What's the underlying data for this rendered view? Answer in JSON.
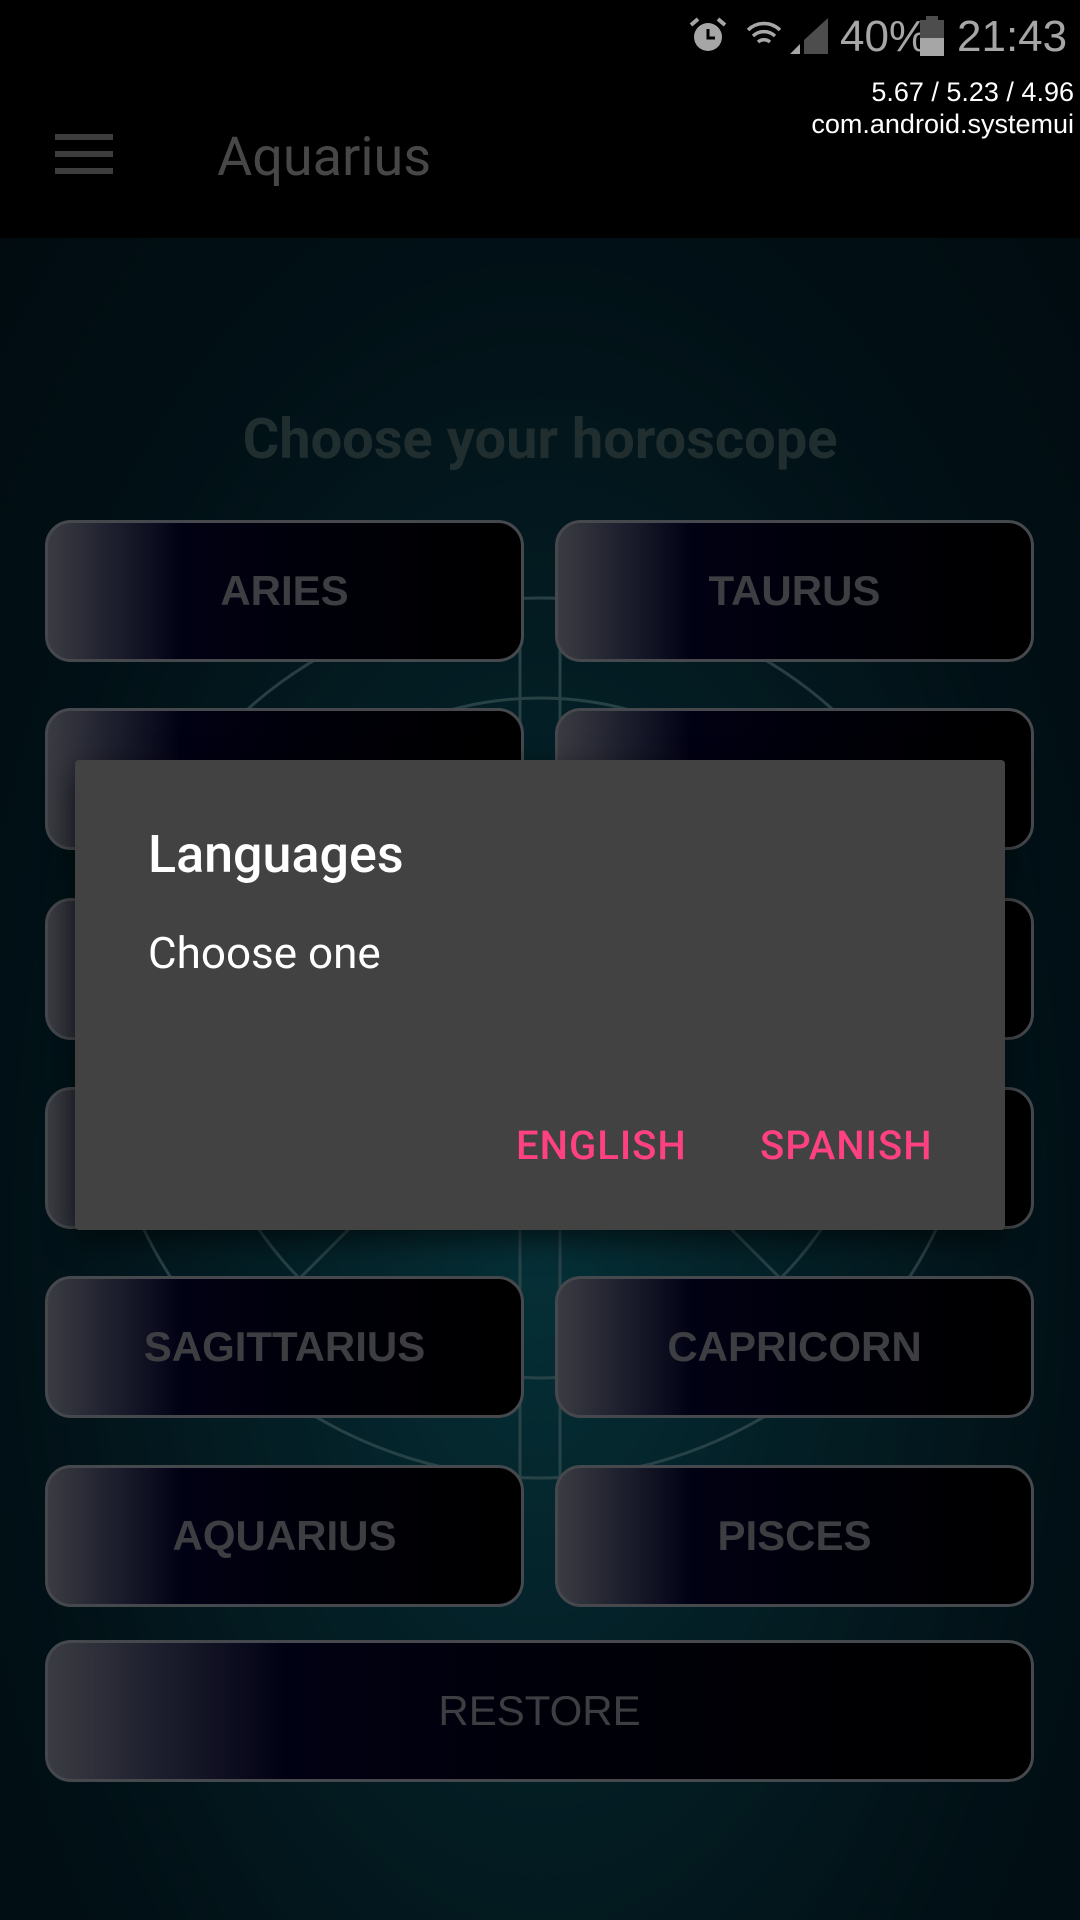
{
  "status_bar": {
    "icons": [
      "alarm-icon",
      "wifi-icon",
      "signal-icon",
      "battery-icon"
    ],
    "battery": "40%",
    "time": "21:43"
  },
  "debug_overlay": {
    "load": "5.67 / 5.23 / 4.96",
    "process": "com.android.systemui"
  },
  "app_bar": {
    "title": "Aquarius",
    "menu_icon": "hamburger-icon"
  },
  "main": {
    "heading": "Choose your horoscope",
    "signs": [
      "ARIES",
      "TAURUS",
      "",
      "",
      "",
      "",
      "",
      "",
      "SAGITTARIUS",
      "CAPRICORN",
      "AQUARIUS",
      "PISCES"
    ],
    "restore": "RESTORE"
  },
  "dialog": {
    "title": "Languages",
    "message": "Choose one",
    "buttons": [
      "ENGLISH",
      "SPANISH"
    ],
    "accent": "#ff4081",
    "background": "#424242"
  }
}
